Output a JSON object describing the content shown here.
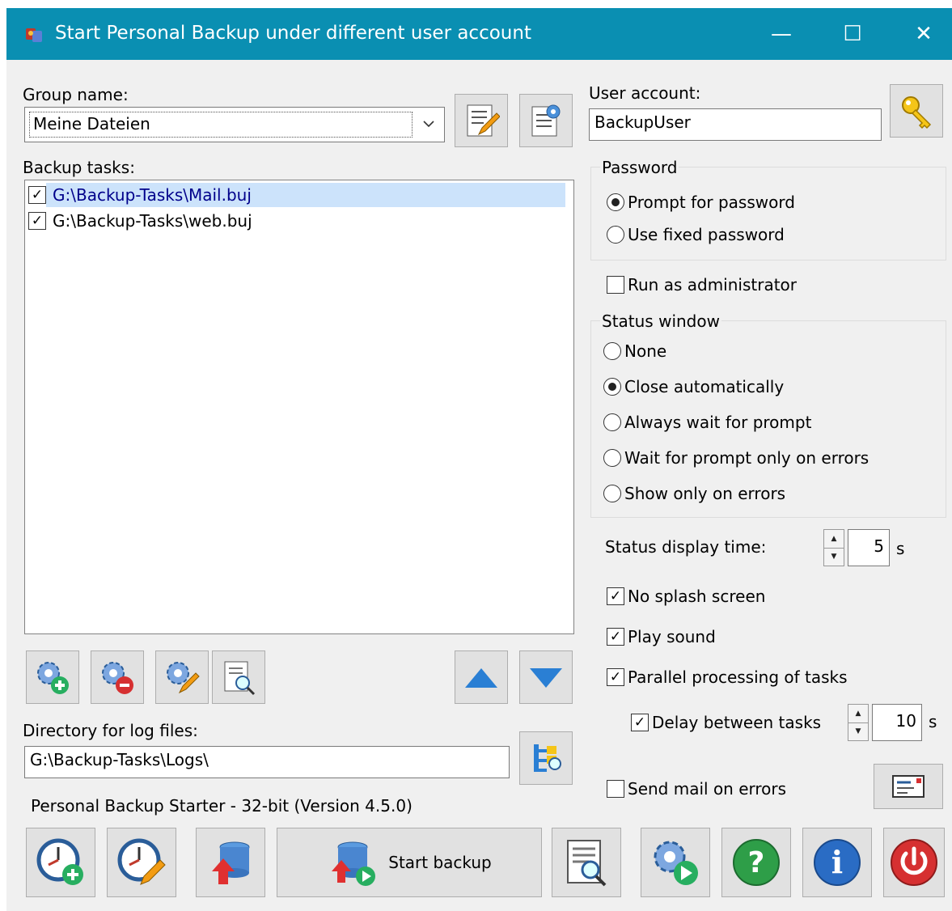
{
  "window": {
    "title": "Start Personal Backup under different user account",
    "controls": {
      "minimize": "—",
      "maximize": "☐",
      "close": "✕"
    }
  },
  "group": {
    "label": "Group name:",
    "value": "Meine Dateien"
  },
  "user": {
    "label": "User account:",
    "value": "BackupUser"
  },
  "tasks": {
    "label": "Backup tasks:",
    "items": [
      {
        "path": "G:\\Backup-Tasks\\Mail.buj",
        "checked": true,
        "selected": true
      },
      {
        "path": "G:\\Backup-Tasks\\web.buj",
        "checked": true,
        "selected": false
      }
    ]
  },
  "password": {
    "title": "Password",
    "options": [
      "Prompt for password",
      "Use fixed password"
    ],
    "selected": "Prompt for password"
  },
  "run_as_admin": {
    "label": "Run as administrator",
    "checked": false
  },
  "status_window": {
    "title": "Status window",
    "options": [
      "None",
      "Close automatically",
      "Always wait for prompt",
      "Wait for prompt only on errors",
      "Show only on errors"
    ],
    "selected": "Close automatically"
  },
  "status_display": {
    "label": "Status display time:",
    "value": "5",
    "unit": "s"
  },
  "no_splash": {
    "label": "No splash screen",
    "checked": true
  },
  "play_sound": {
    "label": "Play sound",
    "checked": true
  },
  "parallel": {
    "label": "Parallel processing of tasks",
    "checked": true
  },
  "delay": {
    "label": "Delay between tasks",
    "checked": true,
    "value": "10",
    "unit": "s"
  },
  "logdir": {
    "label": "Directory for log files:",
    "value": "G:\\Backup-Tasks\\Logs\\"
  },
  "send_mail": {
    "label": "Send mail on errors",
    "checked": false
  },
  "version": "Personal Backup Starter - 32-bit (Version 4.5.0)",
  "start_backup_label": "Start backup",
  "colors": {
    "titlebar": "#0a8fb2",
    "selection": "#cce3fb",
    "accent_blue": "#2a7fd4"
  }
}
